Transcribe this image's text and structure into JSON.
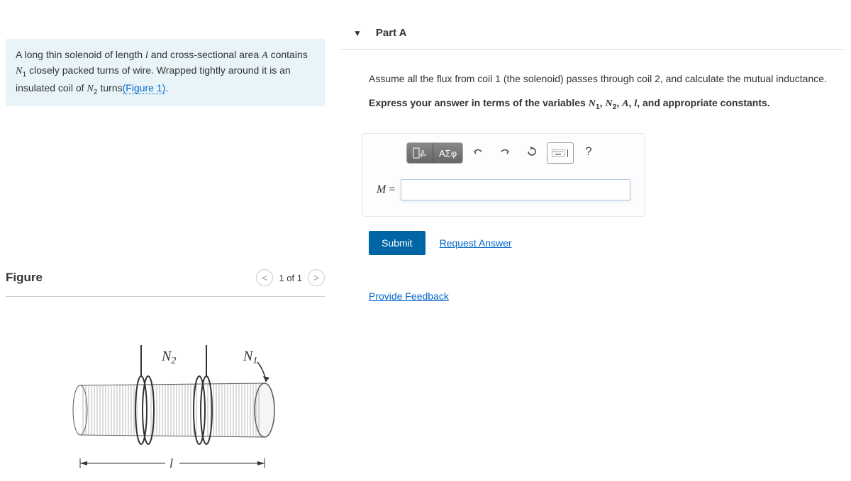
{
  "problem": {
    "text_before": "A long thin solenoid of length ",
    "var1": "l",
    "text2": " and cross-sectional area ",
    "var2": "A",
    "text3": " contains ",
    "var3": "N",
    "sub3": "1",
    "text4": " closely packed turns of wire. Wrapped tightly around it is an insulated coil of ",
    "var4": "N",
    "sub4": "2",
    "text5": " turns",
    "figure_link": "(Figure 1)",
    "text6": "."
  },
  "figure": {
    "title": "Figure",
    "nav_text": "1 of 1",
    "label_n2": "N",
    "sub_n2": "2",
    "label_n1": "N",
    "sub_n1": "1",
    "label_l": "l"
  },
  "part": {
    "title": "Part A",
    "instruction": "Assume all the flux from coil 1 (the solenoid) passes through coil 2, and calculate the mutual inductance.",
    "bold_prefix": "Express your answer in terms of the variables ",
    "bv1": "N",
    "bs1": "1",
    "bsep1": ", ",
    "bv2": "N",
    "bs2": "2",
    "bsep2": ", ",
    "bv3": "A",
    "bsep3": ", ",
    "bv4": "l",
    "bold_suffix": ", and appropriate constants."
  },
  "answer": {
    "eq_label_var": "M",
    "eq_label_eq": " =",
    "tool_greek": "ΑΣφ",
    "help": "?",
    "submit": "Submit",
    "request": "Request Answer"
  },
  "feedback": {
    "link": "Provide Feedback"
  }
}
